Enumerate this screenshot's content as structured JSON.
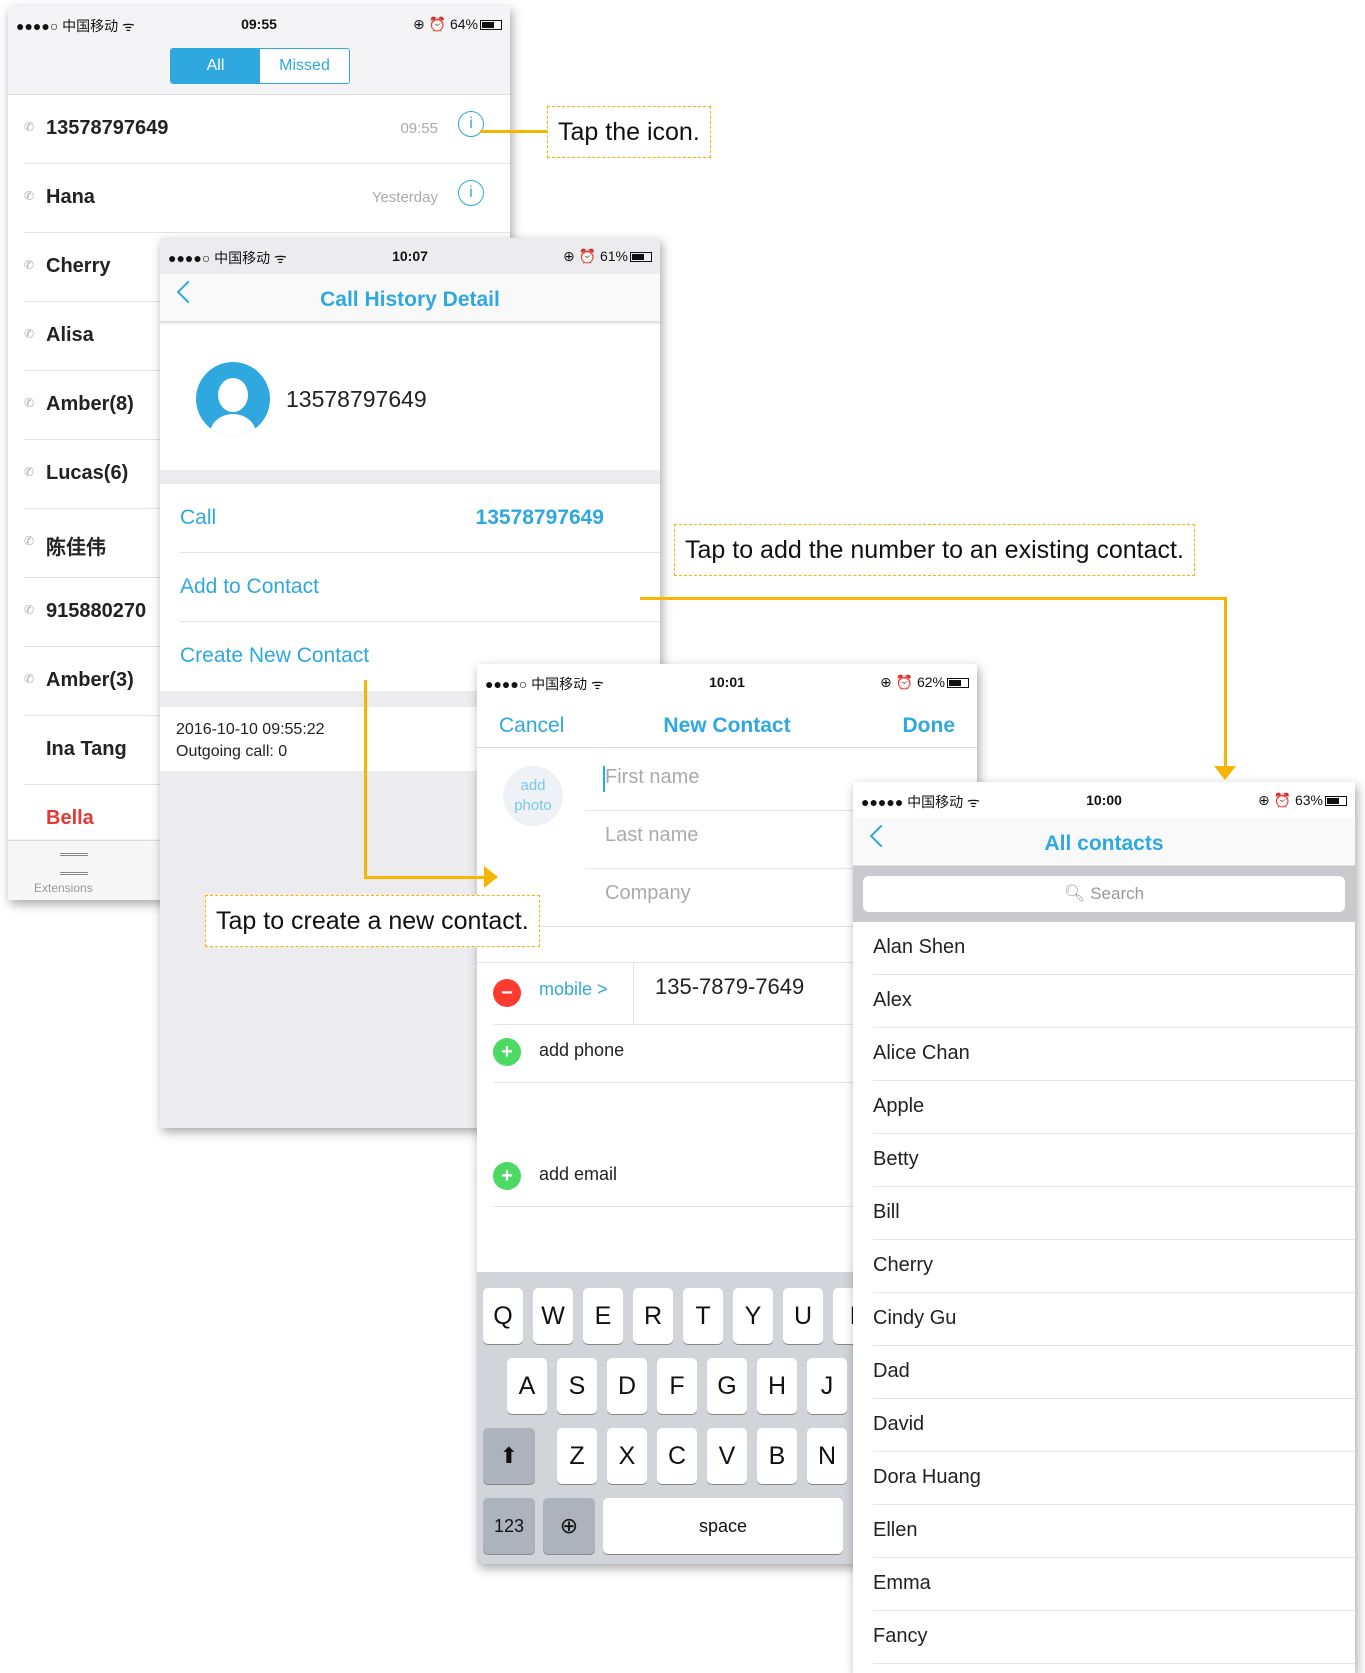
{
  "screen_calls": {
    "status": {
      "carrier": "●●●●○ 中国移动 ᯤ",
      "time": "09:55",
      "battery": "⊕ ⏰ 64%"
    },
    "segments": [
      "All",
      "Missed"
    ],
    "calls": [
      {
        "name": "13578797649",
        "time": "09:55",
        "info": "i"
      },
      {
        "name": "Hana",
        "time": "Yesterday",
        "info": "i"
      },
      {
        "name": "Cherry"
      },
      {
        "name": "Alisa"
      },
      {
        "name": "Amber(8)"
      },
      {
        "name": "Lucas(6)"
      },
      {
        "name": "陈佳伟"
      },
      {
        "name": "915880270"
      },
      {
        "name": "Amber(3)"
      },
      {
        "name": "Ina Tang"
      },
      {
        "name": "Bella"
      }
    ],
    "tab_label": "Extensions"
  },
  "screen_detail": {
    "status": {
      "carrier": "●●●●○ 中国移动 ᯤ",
      "time": "10:07",
      "battery": "⊕ ⏰ 61%"
    },
    "title": "Call History Detail",
    "number": "13578797649",
    "actions": {
      "call": "Call",
      "call_number": "13578797649",
      "add": "Add to Contact",
      "create": "Create New Contact"
    },
    "log": {
      "datetime": "2016-10-10 09:55:22",
      "outgoing": "Outgoing call: 0"
    }
  },
  "screen_new": {
    "status": {
      "carrier": "●●●●○ 中国移动 ᯤ",
      "time": "10:01",
      "battery": "⊕ ⏰ 62%"
    },
    "cancel": "Cancel",
    "title": "New Contact",
    "done": "Done",
    "add_photo": "add photo",
    "first_name": "First name",
    "last_name": "Last name",
    "company": "Company",
    "mobile_label": "mobile >",
    "mobile_value": "135-7879-7649",
    "add_phone": "add phone",
    "add_email": "add email",
    "keys_row1": [
      "Q",
      "W",
      "E",
      "R",
      "T",
      "Y",
      "U",
      "I"
    ],
    "keys_row2": [
      "A",
      "S",
      "D",
      "F",
      "G",
      "H",
      "J"
    ],
    "keys_row3": [
      "Z",
      "X",
      "C",
      "V",
      "B",
      "N"
    ],
    "key_123": "123",
    "key_space": "space",
    "minus": "−",
    "plus": "+",
    "shift": "⬆",
    "globe": "⊕"
  },
  "screen_contacts": {
    "status": {
      "carrier": "●●●●● 中国移动 ᯤ",
      "time": "10:00",
      "battery": "⊕ ⏰ 63%"
    },
    "title": "All contacts",
    "search": "🔍︎ Search",
    "contacts": [
      "Alan Shen",
      "Alex",
      "Alice Chan",
      "Apple",
      "Betty",
      "Bill",
      "Cherry",
      "Cindy Gu",
      "Dad",
      "David",
      "Dora Huang",
      "Ellen",
      "Emma",
      "Fancy"
    ]
  },
  "callouts": {
    "tap_icon": "Tap the icon.",
    "add_existing": "Tap to add the number to an existing contact.",
    "create_new": "Tap to create a new contact."
  },
  "colors": {
    "accent": "#2fa8e0",
    "callout_border": "#f5b500",
    "missed": "#e53935"
  }
}
